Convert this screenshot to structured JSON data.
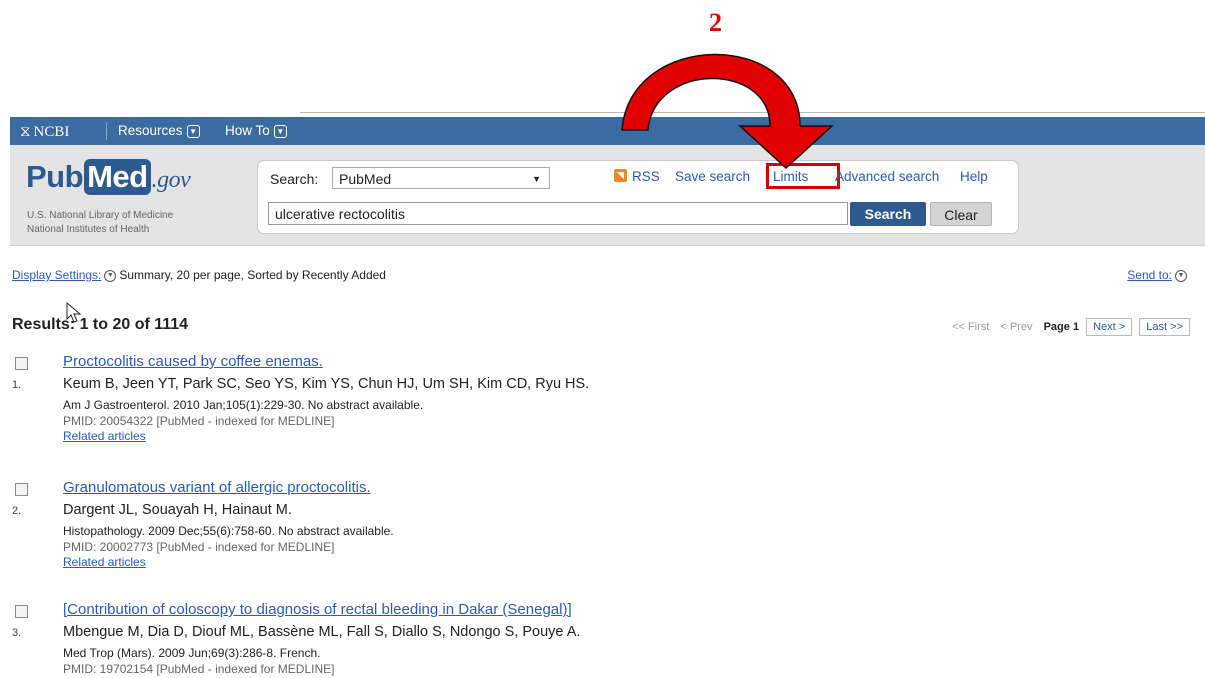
{
  "annotation": {
    "step_number": "2",
    "accent_color": "#e00000"
  },
  "ncbi_bar": {
    "logo": "NCBI",
    "nav": [
      {
        "label": "Resources"
      },
      {
        "label": "How To"
      }
    ]
  },
  "pubmed_logo": {
    "pub": "Pub",
    "med": "Med",
    "gov": ".gov",
    "line1": "U.S. National Library of Medicine",
    "line2": "National Institutes of Health"
  },
  "search": {
    "label": "Search:",
    "database": "PubMed",
    "query": "ulcerative rectocolitis",
    "search_button": "Search",
    "clear_button": "Clear",
    "links": {
      "rss": "RSS",
      "save_search": "Save search",
      "limits": "Limits",
      "advanced_search": "Advanced search",
      "help": "Help"
    }
  },
  "display": {
    "settings_label": "Display Settings:",
    "settings_value": "Summary, 20 per page, Sorted by Recently Added",
    "send_to": "Send to:"
  },
  "results": {
    "title": "Results: 1 to 20 of 1114",
    "pager": {
      "first": "<< First",
      "prev": "< Prev",
      "page": "Page 1",
      "next": "Next >",
      "last": "Last >>"
    },
    "items": [
      {
        "number": "1.",
        "title": "Proctocolitis caused by coffee enemas.",
        "authors": "Keum B, Jeen YT, Park SC, Seo YS, Kim YS, Chun HJ, Um SH, Kim CD, Ryu HS.",
        "journal": "Am J Gastroenterol. 2010 Jan;105(1):229-30. No abstract available.",
        "pmid": "PMID: 20054322 [PubMed - indexed for MEDLINE]",
        "related": "Related articles"
      },
      {
        "number": "2.",
        "title": "Granulomatous variant of allergic proctocolitis.",
        "authors": "Dargent JL, Souayah H, Hainaut M.",
        "journal": "Histopathology. 2009 Dec;55(6):758-60. No abstract available.",
        "pmid": "PMID: 20002773 [PubMed - indexed for MEDLINE]",
        "related": "Related articles"
      },
      {
        "number": "3.",
        "title": "[Contribution of coloscopy to diagnosis of rectal bleeding in Dakar (Senegal)]",
        "authors": "Mbengue M, Dia D, Diouf ML, Bassène ML, Fall S, Diallo S, Ndongo S, Pouye A.",
        "journal": "Med Trop (Mars). 2009 Jun;69(3):286-8. French.",
        "pmid": "PMID: 19702154 [PubMed - indexed for MEDLINE]"
      }
    ]
  }
}
